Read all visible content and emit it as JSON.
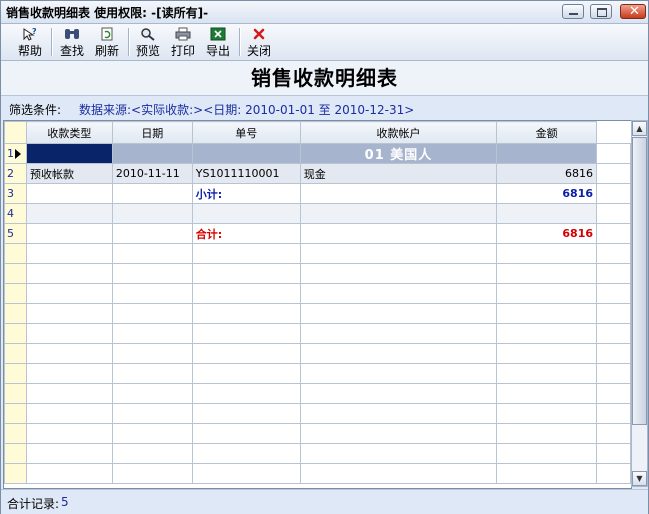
{
  "window": {
    "title": "销售收款明细表  使用权限: -[读所有]-"
  },
  "toolbar": {
    "buttons": [
      {
        "label": "帮助",
        "icon": "help-icon"
      },
      {
        "label": "查找",
        "icon": "binoculars-icon"
      },
      {
        "label": "刷新",
        "icon": "refresh-icon"
      },
      {
        "label": "预览",
        "icon": "magnifier-icon"
      },
      {
        "label": "打印",
        "icon": "printer-icon"
      },
      {
        "label": "导出",
        "icon": "excel-export-icon"
      },
      {
        "label": "关闭",
        "icon": "close-x-icon"
      }
    ]
  },
  "report": {
    "title": "销售收款明细表"
  },
  "filter": {
    "label": "筛选条件:",
    "value": "数据来源:<实际收款:><日期: 2010-01-01  至  2010-12-31>"
  },
  "grid": {
    "columns": [
      "收款类型",
      "日期",
      "单号",
      "收款帐户",
      "金额"
    ],
    "rows": [
      {
        "n": "1",
        "group": "01 美国人"
      },
      {
        "n": "2",
        "type": "预收帐款",
        "date": "2010-11-11",
        "no": "YS1011110001",
        "account": "现金",
        "amount": "6816"
      },
      {
        "n": "3",
        "no": "小计:",
        "amount": "6816"
      },
      {
        "n": "4"
      },
      {
        "n": "5",
        "no": "合计:",
        "amount": "6816"
      }
    ]
  },
  "status": {
    "label": "合计记录:",
    "count": "5"
  },
  "colors": {
    "subtotal": "#0a1ea8",
    "total": "#d40000",
    "group_bg": "#a7b4ce",
    "row_header_bg": "#fffbd7"
  }
}
